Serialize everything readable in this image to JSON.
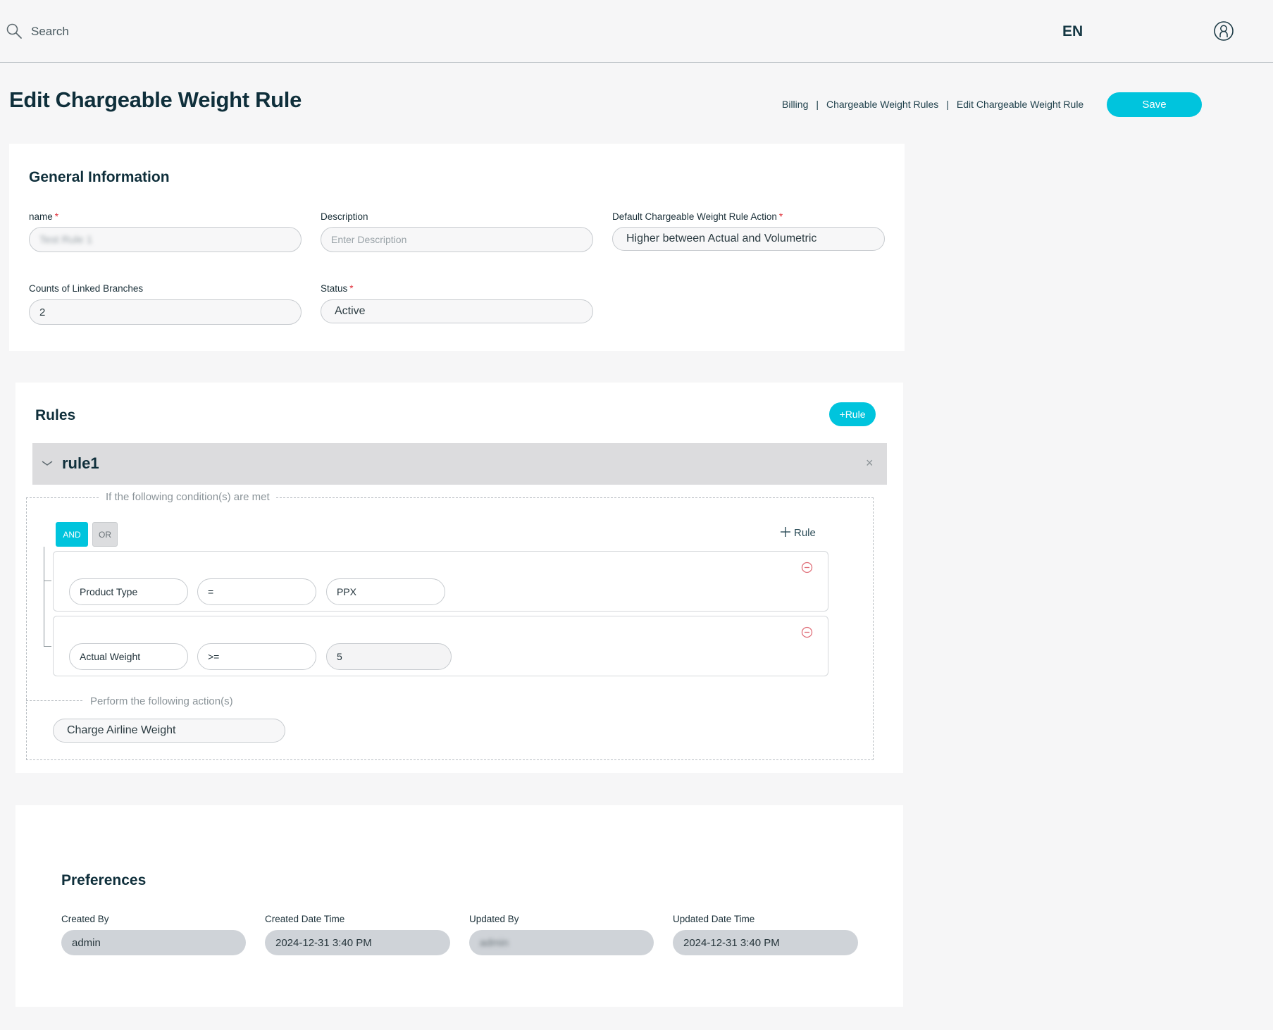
{
  "topbar": {
    "search_placeholder": "Search",
    "language": "EN"
  },
  "header": {
    "title": "Edit Chargeable Weight Rule",
    "breadcrumb": [
      "Billing",
      "Chargeable Weight Rules",
      "Edit Chargeable Weight Rule"
    ],
    "breadcrumb_separator": "|",
    "save_label": "Save"
  },
  "general": {
    "title": "General Information",
    "name": {
      "label": "name",
      "required_mark": "*",
      "value": "Test Rule 1"
    },
    "description": {
      "label": "Description",
      "placeholder": "Enter Description"
    },
    "default_action": {
      "label": "Default Chargeable Weight Rule Action",
      "required_mark": "*",
      "value": "Higher between Actual and Volumetric"
    },
    "linked_branches": {
      "label": "Counts of Linked Branches",
      "value": "2"
    },
    "status": {
      "label": "Status",
      "required_mark": "*",
      "value": "Active"
    }
  },
  "rules": {
    "title": "Rules",
    "add_rule_label": "+Rule",
    "rule": {
      "name": "rule1",
      "close_symbol": "×",
      "condition_legend": "If the following condition(s) are met",
      "and_label": "AND",
      "or_label": "OR",
      "add_condition_label": "Rule",
      "conditions": [
        {
          "field": "Product Type",
          "operator": "=",
          "value": "PPX"
        },
        {
          "field": "Actual Weight",
          "operator": ">=",
          "value": "5"
        }
      ],
      "action_legend": "Perform the following action(s)",
      "action": "Charge Airline Weight"
    }
  },
  "preferences": {
    "title": "Preferences",
    "created_by": {
      "label": "Created By",
      "value": "admin"
    },
    "created_date": {
      "label": "Created Date Time",
      "value": "2024-12-31 3:40 PM"
    },
    "updated_by": {
      "label": "Updated By",
      "value": "admin"
    },
    "updated_date": {
      "label": "Updated Date Time",
      "value": "2024-12-31 3:40 PM"
    }
  },
  "colors": {
    "accent": "#00c4dd",
    "required": "#e0303a",
    "remove": "#e0707a",
    "text_dark": "#0f2f3b"
  },
  "icons": [
    "search-icon",
    "user-icon",
    "chevron-down-icon",
    "close-icon",
    "plus-icon",
    "remove-circle-icon"
  ]
}
